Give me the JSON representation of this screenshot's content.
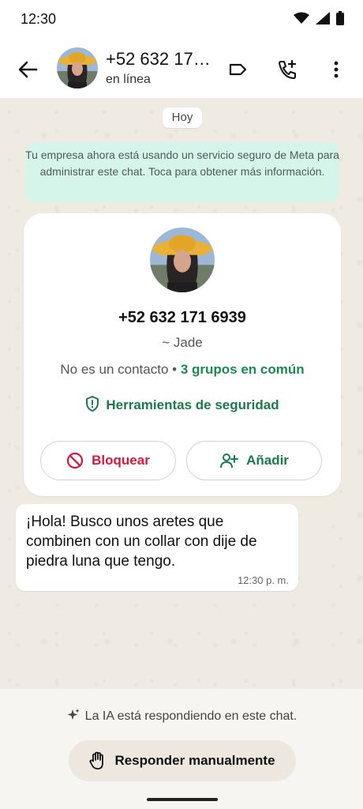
{
  "status_bar": {
    "time": "12:30"
  },
  "header": {
    "title": "+52 632 17…",
    "subtitle": "en línea"
  },
  "chat": {
    "day_label": "Hoy",
    "notice": "Tu empresa ahora está usando un servicio seguro de Meta para administrar este chat. Toca para obtener más información.",
    "card": {
      "phone": "+52 632 171 6939",
      "alias": "~ Jade",
      "not_contact": "No es un contacto",
      "separator": "•",
      "groups": "3 grupos en común",
      "safety_tools": "Herramientas de seguridad",
      "block_label": "Bloquear",
      "add_label": "Añadir"
    },
    "message": {
      "text": "¡Hola! Busco unos aretes que combinen con un collar con dije de piedra luna que tengo.",
      "time": "12:30 p. m."
    }
  },
  "bottom": {
    "ai_notice": "La IA está respondiendo en este chat.",
    "manual_button": "Responder manualmente"
  },
  "colors": {
    "accent_green": "#1a7a4c",
    "block_red": "#d6193a",
    "notice_bg": "#d6f5ea",
    "chat_bg": "#efeae2"
  }
}
